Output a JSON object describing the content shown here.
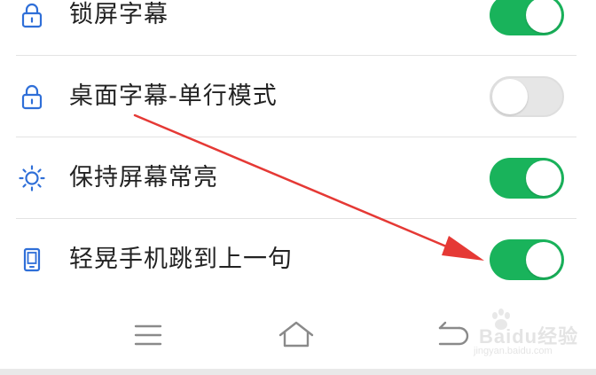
{
  "settings": {
    "items": [
      {
        "label": "锁屏字幕",
        "icon": "lock-icon",
        "enabled": true
      },
      {
        "label": "桌面字幕-单行模式",
        "icon": "lock-icon",
        "enabled": false
      },
      {
        "label": "保持屏幕常亮",
        "icon": "sun-icon",
        "enabled": true
      },
      {
        "label": "轻晃手机跳到上一句",
        "icon": "phone-icon",
        "enabled": true
      }
    ]
  },
  "nav": {
    "buttons": [
      "menu-icon",
      "home-icon",
      "back-icon"
    ]
  },
  "watermark": {
    "text": "Baidu经验",
    "sub": "jingyan.baidu.com"
  },
  "colors": {
    "toggle_on": "#19b35b",
    "toggle_off": "#e6e6e6",
    "icon_blue": "#2f6fd8",
    "annotation_arrow": "#e53935"
  }
}
